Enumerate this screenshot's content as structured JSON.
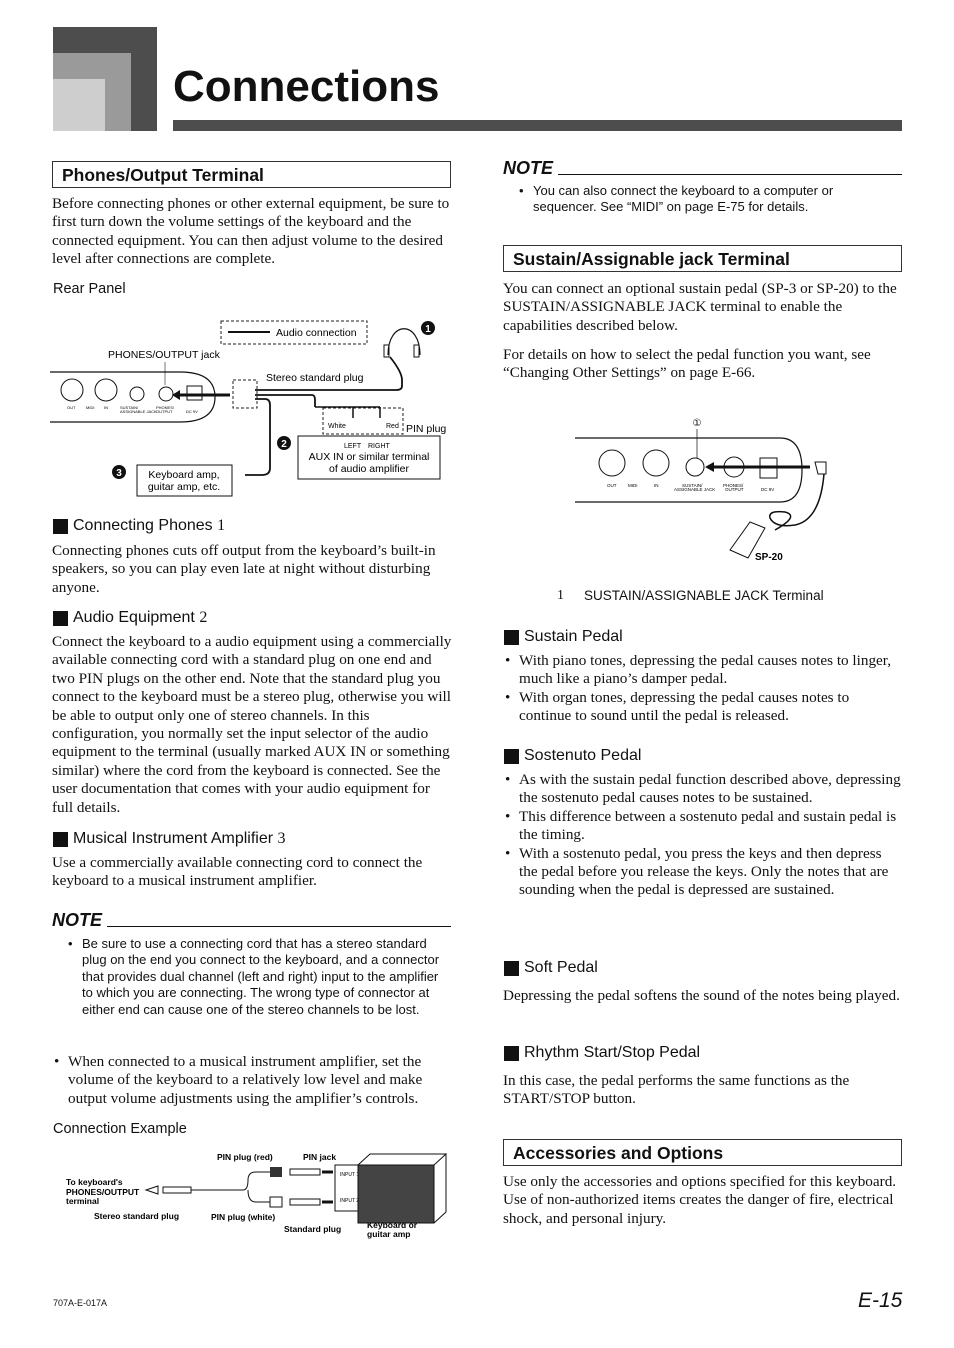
{
  "header": {
    "title": "Connections"
  },
  "left": {
    "phones_heading": "Phones/Output Terminal",
    "intro": "Before connecting phones or other external equipment, be sure to first turn down the volume settings of the keyboard and the connected equipment. You can then adjust volume to the desired level after connections are complete.",
    "rear_panel_label": "Rear Panel",
    "diagram": {
      "legend": "Audio connection",
      "phones_jack": "PHONES/OUTPUT jack",
      "stereo_plug": "Stereo standard plug",
      "white": "White",
      "red": "Red",
      "pin_plug": "PIN plug",
      "left": "LEFT",
      "right": "RIGHT",
      "aux_line1": "AUX IN or similar terminal",
      "aux_line2": "of audio amplifier",
      "amp_line1": "Keyboard amp,",
      "amp_line2": "guitar amp, etc.",
      "n1": "1",
      "n2": "2",
      "n3": "3",
      "midi_out": "OUT",
      "midi": "MIDI",
      "midi_in": "IN",
      "sustain_lbl1": "SUSTAIN/",
      "sustain_lbl2": "ASSIGNABLE JACK",
      "phones_lbl1": "PHONES/",
      "phones_lbl2": "OUTPUT",
      "dc_lbl": "DC 9V"
    },
    "phones_sub": "Connecting Phones",
    "phones_sub_num": "1",
    "phones_text": "Connecting phones cuts off output from the keyboard’s built-in speakers, so you can play even late at night without disturbing anyone.",
    "audio_sub": "Audio Equipment",
    "audio_sub_num": "2",
    "audio_text": "Connect the keyboard to a audio equipment using a commercially available connecting cord with a standard plug on one end and two PIN plugs on the other end. Note that the standard plug you connect to the keyboard must be a stereo plug, otherwise you will be able to output only one of stereo channels. In this configuration, you normally set the input selector of the audio equipment to the terminal (usually marked AUX IN or something similar) where the cord from the keyboard is connected. See the user documentation that comes with your audio equipment for full details.",
    "amp_sub": "Musical Instrument Amplifier",
    "amp_sub_num": "3",
    "amp_text": "Use a commercially available connecting cord to connect the keyboard to a musical instrument amplifier.",
    "note_label": "NOTE",
    "note_items": [
      "Be sure to use a connecting cord that has a stereo standard plug on the end you connect to the keyboard, and a connector that provides dual channel (left and right) input to the amplifier to which you are connecting. The wrong type of connector at either end can cause one of the stereo channels to be lost."
    ],
    "note_item2": "When connected to a musical instrument amplifier, set the volume of the keyboard to a relatively low level and make output volume adjustments using the amplifier’s controls.",
    "example_label": "Connection Example",
    "example": {
      "to_kb1": "To keyboard's",
      "to_kb2": "PHONES/OUTPUT",
      "to_kb3": "terminal",
      "stereo": "Stereo standard plug",
      "pin_red": "PIN plug (red)",
      "pin_white": "PIN plug (white)",
      "pin_jack": "PIN jack",
      "std_plug": "Standard plug",
      "amp1": "Keyboard or",
      "amp2": "guitar amp",
      "in1": "INPUT 1",
      "in2": "INPUT 2"
    }
  },
  "right": {
    "note_label": "NOTE",
    "note_item": "You can also connect the keyboard to a computer or sequencer. See “MIDI” on page E-75 for details.",
    "sustain_heading": "Sustain/Assignable jack Terminal",
    "sustain_p1": "You can connect an optional sustain pedal (SP-3 or SP-20) to the SUSTAIN/ASSIGNABLE JACK terminal to enable the capabilities described below.",
    "sustain_p2": "For details on how to select the pedal function you want, see “Changing Other Settings” on page E-66.",
    "diagram": {
      "marker": "①",
      "pedal": "SP-20",
      "midi_out": "OUT",
      "midi": "MIDI",
      "midi_in": "IN",
      "sustain_lbl1": "SUSTAIN/",
      "sustain_lbl2": "ASSIGNABLE JACK",
      "phones_lbl1": "PHONES/",
      "phones_lbl2": "OUTPUT",
      "dc_lbl": "DC 9V"
    },
    "caption_num": "1",
    "caption": "SUSTAIN/ASSIGNABLE JACK Terminal",
    "sustain_sub": "Sustain Pedal",
    "sustain_items": [
      "With piano tones, depressing the pedal causes notes to linger, much like a piano’s damper pedal.",
      "With organ tones, depressing the pedal causes notes to continue to sound until the pedal is released."
    ],
    "sostenuto_sub": "Sostenuto Pedal",
    "sostenuto_items": [
      "As with the sustain pedal function described above, depressing the sostenuto pedal causes notes to be sustained.",
      "This difference between a sostenuto pedal and sustain pedal is the timing.",
      "With a sostenuto pedal, you press the keys and then depress the pedal before you release the keys. Only the notes that are sounding when the pedal is depressed are sustained."
    ],
    "soft_sub": "Soft Pedal",
    "soft_text": "Depressing the pedal softens the sound of the notes being played.",
    "rhythm_sub": "Rhythm Start/Stop Pedal",
    "rhythm_text": "In this case, the pedal performs the same functions as the START/STOP button.",
    "acc_heading": "Accessories and Options",
    "acc_text": "Use only the accessories and options specified for this keyboard. Use of non-authorized items creates the danger of fire, electrical shock, and personal injury."
  },
  "footer": {
    "code": "707A-E-017A",
    "page": "E-15"
  }
}
